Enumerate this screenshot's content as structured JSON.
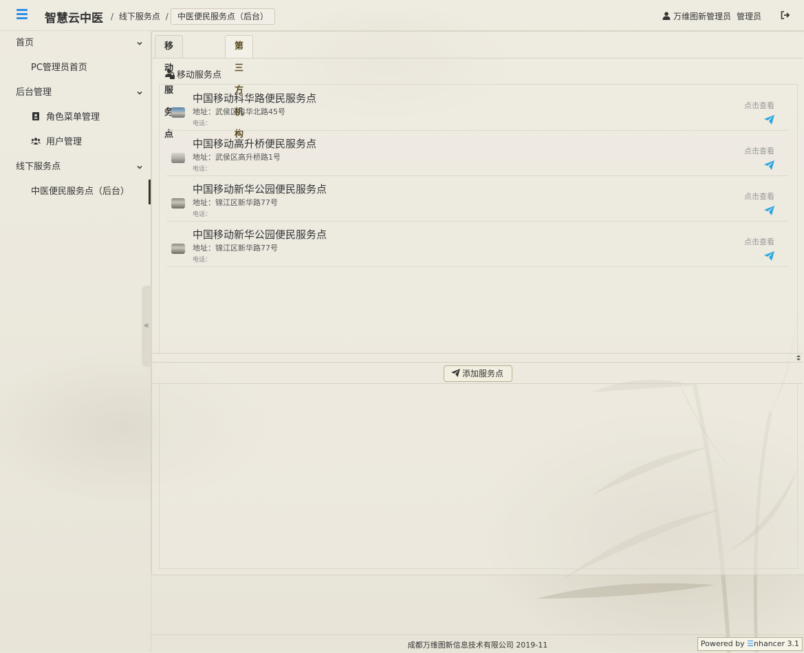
{
  "header": {
    "app_title": "智慧云中医",
    "breadcrumb": {
      "parent": "线下服务点",
      "separator": "/",
      "current": "中医便民服务点（后台）"
    },
    "user": {
      "name": "万维图新管理员",
      "role": "管理员"
    },
    "icons": {
      "menu": "hamburger-icon",
      "user": "user-icon",
      "logout": "logout-icon"
    },
    "accent_color": "#2b8ee8"
  },
  "sidebar": {
    "groups": [
      {
        "label": "首页",
        "items": [
          {
            "label": "PC管理员首页",
            "icon": ""
          }
        ]
      },
      {
        "label": "后台管理",
        "items": [
          {
            "label": "角色菜单管理",
            "icon": "address-book-icon"
          },
          {
            "label": "用户管理",
            "icon": "users-icon"
          }
        ]
      },
      {
        "label": "线下服务点",
        "items": [
          {
            "label": "中医便民服务点（后台）",
            "icon": "",
            "active": true
          }
        ]
      }
    ],
    "collapse_glyph": "«"
  },
  "tabs": [
    {
      "label": "移动服务点",
      "active": true
    },
    {
      "label": "第三方机构",
      "active": false
    }
  ],
  "section_label": "移动服务点",
  "service_points": [
    {
      "name": "中国移动科华路便民服务点",
      "address": "地址：武侯区科华北路45号",
      "phone": "电话：",
      "view_label": "点击查看"
    },
    {
      "name": "中国移动高升桥便民服务点",
      "address": "地址：武侯区高升桥路1号",
      "phone": "电话：",
      "view_label": "点击查看"
    },
    {
      "name": "中国移动新华公园便民服务点",
      "address": "地址：锦江区新华路77号",
      "phone": "电话：",
      "view_label": "点击查看"
    },
    {
      "name": "中国移动新华公园便民服务点",
      "address": "地址：锦江区新华路77号",
      "phone": "电话：",
      "view_label": "点击查看"
    }
  ],
  "add_button_label": "添加服务点",
  "footer": {
    "copyright": "成都万维图新信息技术有限公司 2019-11",
    "powered_prefix": "Powered by",
    "powered_brand": "nhancer 3.1"
  },
  "send_icon_color": "#2aa7e0"
}
